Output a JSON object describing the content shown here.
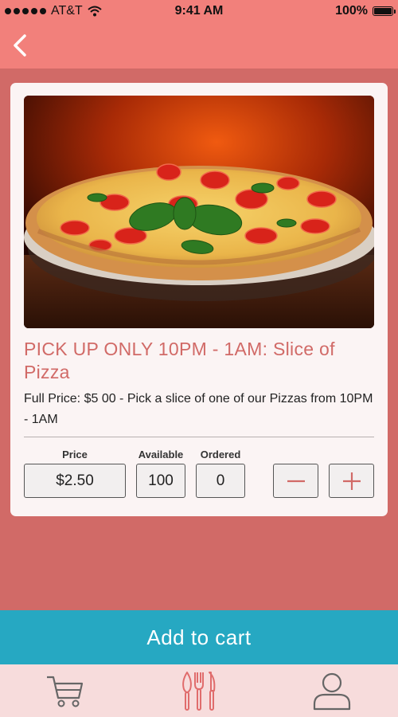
{
  "status_bar": {
    "carrier": "AT&T",
    "time": "9:41 AM",
    "battery": "100%"
  },
  "product": {
    "title": "PICK UP ONLY 10PM - 1AM: Slice of Pizza",
    "description": "Full Price: $5 00 - Pick a slice of one of our Pizzas from 10PM - 1AM",
    "price_label": "Price",
    "price_value": "$2.50",
    "available_label": "Available",
    "available_value": "100",
    "ordered_label": "Ordered",
    "ordered_value": "0"
  },
  "actions": {
    "add_to_cart": "Add to cart"
  },
  "icons": {
    "back": "chevron-left-icon",
    "decrement": "minus-icon",
    "increment": "plus-icon",
    "tab_cart": "cart-icon",
    "tab_menu": "fork-knife-icon",
    "tab_profile": "user-icon"
  },
  "colors": {
    "header": "#f2807b",
    "background": "#d16a67",
    "accent": "#d16a67",
    "add_to_cart": "#26a8c2",
    "tab_bar": "#f7dcdc"
  }
}
